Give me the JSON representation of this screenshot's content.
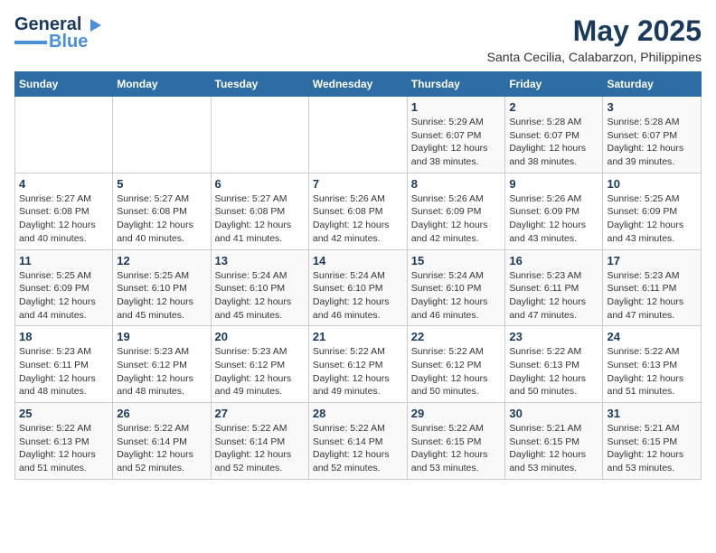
{
  "logo": {
    "line1": "General",
    "line2": "Blue"
  },
  "title": "May 2025",
  "subtitle": "Santa Cecilia, Calabarzon, Philippines",
  "days_of_week": [
    "Sunday",
    "Monday",
    "Tuesday",
    "Wednesday",
    "Thursday",
    "Friday",
    "Saturday"
  ],
  "weeks": [
    [
      {
        "day": "",
        "info": ""
      },
      {
        "day": "",
        "info": ""
      },
      {
        "day": "",
        "info": ""
      },
      {
        "day": "",
        "info": ""
      },
      {
        "day": "1",
        "info": "Sunrise: 5:29 AM\nSunset: 6:07 PM\nDaylight: 12 hours\nand 38 minutes."
      },
      {
        "day": "2",
        "info": "Sunrise: 5:28 AM\nSunset: 6:07 PM\nDaylight: 12 hours\nand 38 minutes."
      },
      {
        "day": "3",
        "info": "Sunrise: 5:28 AM\nSunset: 6:07 PM\nDaylight: 12 hours\nand 39 minutes."
      }
    ],
    [
      {
        "day": "4",
        "info": "Sunrise: 5:27 AM\nSunset: 6:08 PM\nDaylight: 12 hours\nand 40 minutes."
      },
      {
        "day": "5",
        "info": "Sunrise: 5:27 AM\nSunset: 6:08 PM\nDaylight: 12 hours\nand 40 minutes."
      },
      {
        "day": "6",
        "info": "Sunrise: 5:27 AM\nSunset: 6:08 PM\nDaylight: 12 hours\nand 41 minutes."
      },
      {
        "day": "7",
        "info": "Sunrise: 5:26 AM\nSunset: 6:08 PM\nDaylight: 12 hours\nand 42 minutes."
      },
      {
        "day": "8",
        "info": "Sunrise: 5:26 AM\nSunset: 6:09 PM\nDaylight: 12 hours\nand 42 minutes."
      },
      {
        "day": "9",
        "info": "Sunrise: 5:26 AM\nSunset: 6:09 PM\nDaylight: 12 hours\nand 43 minutes."
      },
      {
        "day": "10",
        "info": "Sunrise: 5:25 AM\nSunset: 6:09 PM\nDaylight: 12 hours\nand 43 minutes."
      }
    ],
    [
      {
        "day": "11",
        "info": "Sunrise: 5:25 AM\nSunset: 6:09 PM\nDaylight: 12 hours\nand 44 minutes."
      },
      {
        "day": "12",
        "info": "Sunrise: 5:25 AM\nSunset: 6:10 PM\nDaylight: 12 hours\nand 45 minutes."
      },
      {
        "day": "13",
        "info": "Sunrise: 5:24 AM\nSunset: 6:10 PM\nDaylight: 12 hours\nand 45 minutes."
      },
      {
        "day": "14",
        "info": "Sunrise: 5:24 AM\nSunset: 6:10 PM\nDaylight: 12 hours\nand 46 minutes."
      },
      {
        "day": "15",
        "info": "Sunrise: 5:24 AM\nSunset: 6:10 PM\nDaylight: 12 hours\nand 46 minutes."
      },
      {
        "day": "16",
        "info": "Sunrise: 5:23 AM\nSunset: 6:11 PM\nDaylight: 12 hours\nand 47 minutes."
      },
      {
        "day": "17",
        "info": "Sunrise: 5:23 AM\nSunset: 6:11 PM\nDaylight: 12 hours\nand 47 minutes."
      }
    ],
    [
      {
        "day": "18",
        "info": "Sunrise: 5:23 AM\nSunset: 6:11 PM\nDaylight: 12 hours\nand 48 minutes."
      },
      {
        "day": "19",
        "info": "Sunrise: 5:23 AM\nSunset: 6:12 PM\nDaylight: 12 hours\nand 48 minutes."
      },
      {
        "day": "20",
        "info": "Sunrise: 5:23 AM\nSunset: 6:12 PM\nDaylight: 12 hours\nand 49 minutes."
      },
      {
        "day": "21",
        "info": "Sunrise: 5:22 AM\nSunset: 6:12 PM\nDaylight: 12 hours\nand 49 minutes."
      },
      {
        "day": "22",
        "info": "Sunrise: 5:22 AM\nSunset: 6:12 PM\nDaylight: 12 hours\nand 50 minutes."
      },
      {
        "day": "23",
        "info": "Sunrise: 5:22 AM\nSunset: 6:13 PM\nDaylight: 12 hours\nand 50 minutes."
      },
      {
        "day": "24",
        "info": "Sunrise: 5:22 AM\nSunset: 6:13 PM\nDaylight: 12 hours\nand 51 minutes."
      }
    ],
    [
      {
        "day": "25",
        "info": "Sunrise: 5:22 AM\nSunset: 6:13 PM\nDaylight: 12 hours\nand 51 minutes."
      },
      {
        "day": "26",
        "info": "Sunrise: 5:22 AM\nSunset: 6:14 PM\nDaylight: 12 hours\nand 52 minutes."
      },
      {
        "day": "27",
        "info": "Sunrise: 5:22 AM\nSunset: 6:14 PM\nDaylight: 12 hours\nand 52 minutes."
      },
      {
        "day": "28",
        "info": "Sunrise: 5:22 AM\nSunset: 6:14 PM\nDaylight: 12 hours\nand 52 minutes."
      },
      {
        "day": "29",
        "info": "Sunrise: 5:22 AM\nSunset: 6:15 PM\nDaylight: 12 hours\nand 53 minutes."
      },
      {
        "day": "30",
        "info": "Sunrise: 5:21 AM\nSunset: 6:15 PM\nDaylight: 12 hours\nand 53 minutes."
      },
      {
        "day": "31",
        "info": "Sunrise: 5:21 AM\nSunset: 6:15 PM\nDaylight: 12 hours\nand 53 minutes."
      }
    ]
  ]
}
